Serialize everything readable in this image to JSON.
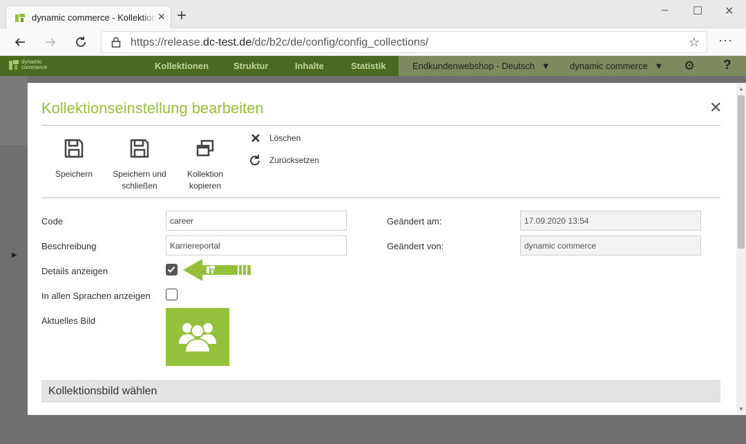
{
  "browser": {
    "tab_title": "dynamic commerce - Kollektionen",
    "url_prefix": "https://release.",
    "url_host": "dc-test.de",
    "url_path": "/dc/b2c/de/config/config_collections/"
  },
  "appbar": {
    "brand": "dynamic commerce",
    "nav": [
      "Kollektionen",
      "Struktur",
      "Inhalte",
      "Statistik"
    ],
    "shop_select": "Endkundenwebshop - Deutsch",
    "company_select": "dynamic commerce",
    "help": "?"
  },
  "modal": {
    "title": "Kollektionseinstellung bearbeiten",
    "toolbar": {
      "save": "Speichern",
      "save_close_line1": "Speichern und",
      "save_close_line2": "schließen",
      "copy_line1": "Kollektion",
      "copy_line2": "kopieren",
      "delete": "Löschen",
      "reset": "Zurücksetzen"
    },
    "fields": {
      "code_label": "Code",
      "code_value": "career",
      "description_label": "Beschreibung",
      "description_value": "Karriereportal",
      "show_details_label": "Details anzeigen",
      "show_details_checked": true,
      "all_languages_label": "In allen Sprachen anzeigen",
      "all_languages_checked": false,
      "current_image_label": "Aktuelles Bild",
      "changed_at_label": "Geändert am:",
      "changed_at_value": "17.09.2020 13:54",
      "changed_by_label": "Geändert von:",
      "changed_by_value": "dynamic commerce"
    },
    "section_title": "Kollektionsbild wählen"
  },
  "colors": {
    "accent_green": "#95c03c",
    "header_dark_green": "#4b6a1f"
  }
}
